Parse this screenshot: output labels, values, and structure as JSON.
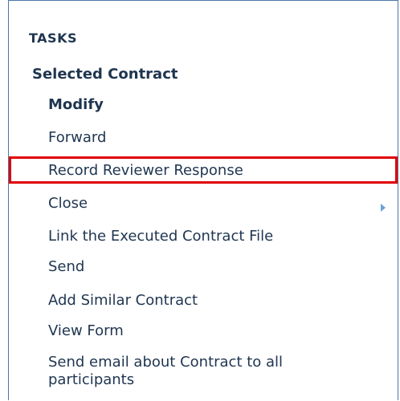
{
  "tasks": {
    "heading": "TASKS",
    "section_title": "Selected Contract",
    "items": [
      {
        "label": "Modify"
      },
      {
        "label": "Forward"
      },
      {
        "label": "Record Reviewer Response"
      },
      {
        "label": "Close"
      },
      {
        "label": "Link the Executed Contract File"
      },
      {
        "label": "Send"
      },
      {
        "label": "Add Similar Contract"
      },
      {
        "label": "View Form"
      },
      {
        "label": "Send email about Contract to all participants"
      }
    ]
  },
  "icons": {
    "submenu_arrow": "chevron-right-icon"
  },
  "colors": {
    "text": "#1f3550",
    "panel_border": "#4a76a8",
    "highlight": "#e00000",
    "arrow": "#6aa3d6"
  }
}
